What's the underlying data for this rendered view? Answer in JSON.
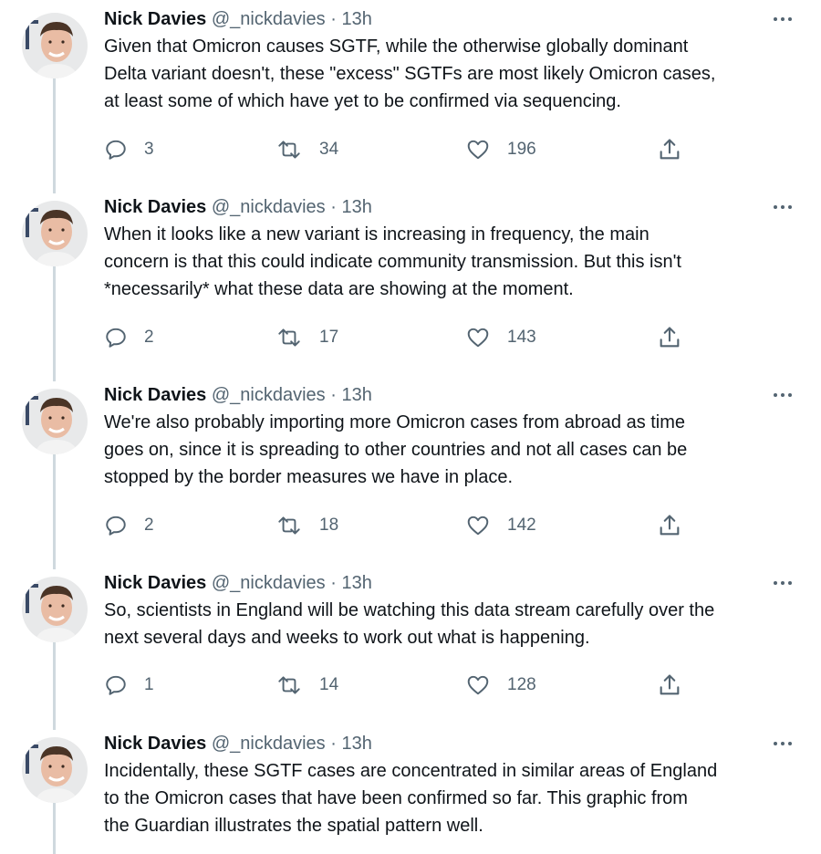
{
  "author": {
    "name": "Nick Davies",
    "handle": "@_nickdavies",
    "separator": "·"
  },
  "tweets": [
    {
      "time": "13h",
      "lines": [
        "Given that Omicron causes SGTF, while the otherwise globally dominant",
        "Delta variant doesn't, these \"excess\" SGTFs are most likely Omicron cases,",
        "at least some of which have yet to be confirmed via sequencing."
      ],
      "replies": "3",
      "retweets": "34",
      "likes": "196"
    },
    {
      "time": "13h",
      "lines": [
        "When it looks like a new variant is increasing in frequency, the main",
        "concern is that this could indicate community transmission. But this isn't",
        "*necessarily* what these data are showing at the moment."
      ],
      "replies": "2",
      "retweets": "17",
      "likes": "143"
    },
    {
      "time": "13h",
      "lines": [
        "We're also probably importing more Omicron cases from abroad as time",
        "goes on, since it is spreading to other countries and not all cases can be",
        "stopped by the border measures we have in place."
      ],
      "replies": "2",
      "retweets": "18",
      "likes": "142"
    },
    {
      "time": "13h",
      "lines": [
        "So, scientists in England will be watching this data stream carefully over the",
        "next several days and weeks to work out what is happening."
      ],
      "replies": "1",
      "retweets": "14",
      "likes": "128"
    },
    {
      "time": "13h",
      "lines": [
        "Incidentally, these SGTF cases are concentrated in similar areas of England",
        "to the Omicron cases that have been confirmed so far. This graphic from",
        "the Guardian illustrates the spatial pattern well."
      ]
    }
  ],
  "icons": {
    "avatar": "avatar-photo",
    "more": "more-icon",
    "reply": "reply-icon",
    "retweet": "retweet-icon",
    "like": "like-icon",
    "share": "share-icon"
  },
  "colors": {
    "text": "#0f1419",
    "secondary": "#536471",
    "thread_line": "#cfd9de"
  }
}
